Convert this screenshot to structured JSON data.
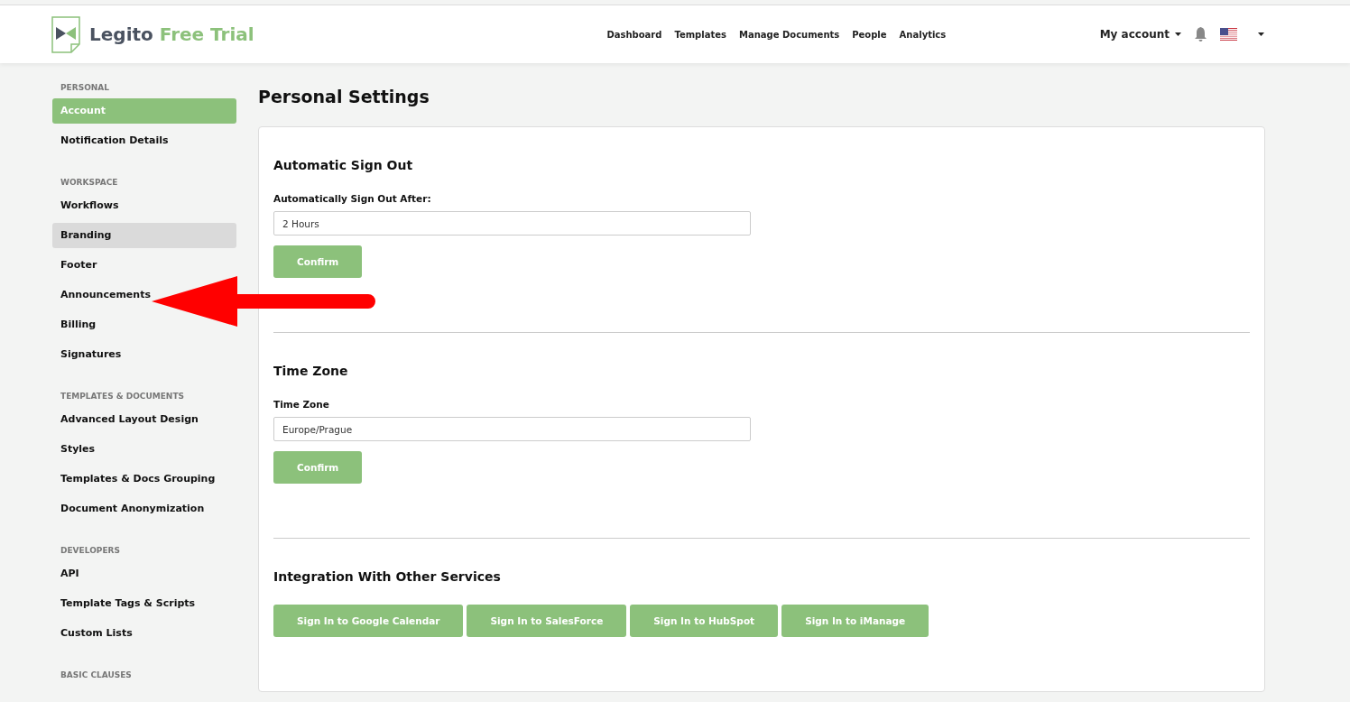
{
  "header": {
    "brand": "Legito",
    "brand_suffix": "Free Trial",
    "nav": [
      "Dashboard",
      "Templates",
      "Manage Documents",
      "People",
      "Analytics"
    ],
    "account": "My account"
  },
  "sidebar": [
    {
      "title": "PERSONAL",
      "items": [
        {
          "label": "Account",
          "selected": true,
          "hovered": false
        },
        {
          "label": "Notification Details",
          "selected": false,
          "hovered": false
        }
      ]
    },
    {
      "title": "WORKSPACE",
      "items": [
        {
          "label": "Workflows",
          "selected": false,
          "hovered": false
        },
        {
          "label": "Branding",
          "selected": false,
          "hovered": true
        },
        {
          "label": "Footer",
          "selected": false,
          "hovered": false
        },
        {
          "label": "Announcements",
          "selected": false,
          "hovered": false
        },
        {
          "label": "Billing",
          "selected": false,
          "hovered": false
        },
        {
          "label": "Signatures",
          "selected": false,
          "hovered": false
        }
      ]
    },
    {
      "title": "TEMPLATES & DOCUMENTS",
      "items": [
        {
          "label": "Advanced Layout Design",
          "selected": false,
          "hovered": false
        },
        {
          "label": "Styles",
          "selected": false,
          "hovered": false
        },
        {
          "label": "Templates & Docs Grouping",
          "selected": false,
          "hovered": false
        },
        {
          "label": "Document Anonymization",
          "selected": false,
          "hovered": false
        }
      ]
    },
    {
      "title": "DEVELOPERS",
      "items": [
        {
          "label": "API",
          "selected": false,
          "hovered": false
        },
        {
          "label": "Template Tags & Scripts",
          "selected": false,
          "hovered": false
        },
        {
          "label": "Custom Lists",
          "selected": false,
          "hovered": false
        }
      ]
    },
    {
      "title": "BASIC CLAUSES"
    }
  ],
  "page_title": "Personal Settings",
  "sections": [
    {
      "kind": "field",
      "title": "Automatic Sign Out",
      "field_label": "Automatically Sign Out After:",
      "value": "2 Hours",
      "button": "Confirm"
    },
    {
      "kind": "field",
      "title": "Time Zone",
      "field_label": "Time Zone",
      "value": "Europe/Prague",
      "button": "Confirm"
    },
    {
      "kind": "buttons",
      "title": "Integration With Other Services",
      "buttons": [
        "Sign In to Google Calendar",
        "Sign In to SalesForce",
        "Sign In to HubSpot",
        "Sign In to iManage"
      ]
    }
  ]
}
